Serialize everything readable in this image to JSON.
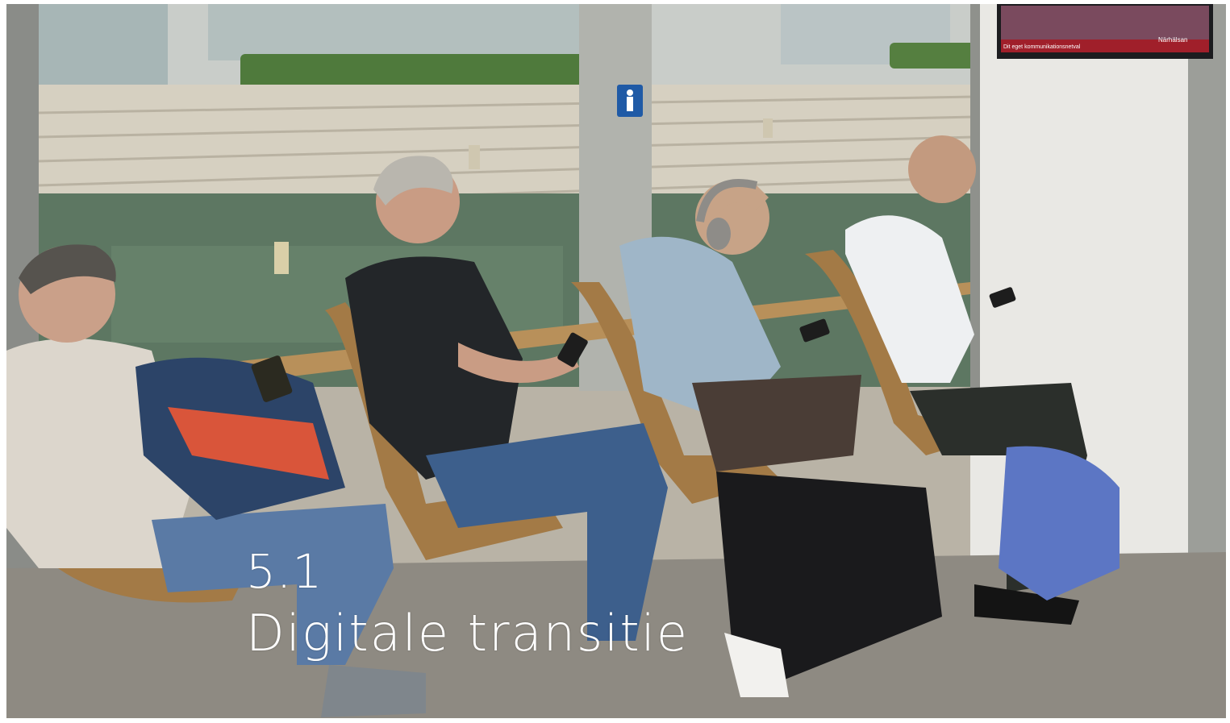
{
  "section": {
    "number": "5.1",
    "title": "Digitale transitie"
  },
  "screen": {
    "left_text": "Dit eget kommunikationsnetval",
    "right_text": "Närhälsan"
  },
  "colors": {
    "water": "#5d7762",
    "wall": "#e9e8e4",
    "seat_wood": "#a37a46",
    "floor": "#8e8a82",
    "title_text": "#ffffff"
  },
  "icons": [
    "person-sign-icon"
  ]
}
